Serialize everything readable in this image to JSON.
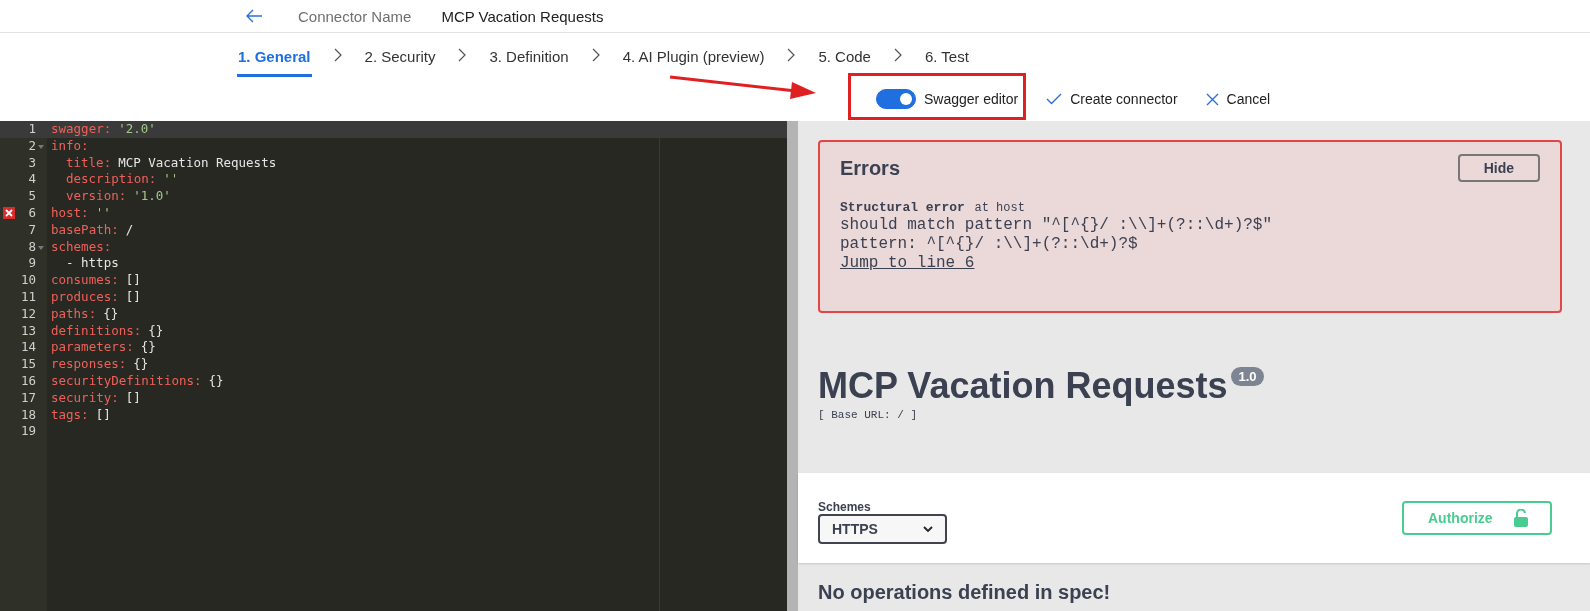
{
  "header": {
    "label": "Connector Name",
    "connector_name": "MCP Vacation Requests"
  },
  "steps": [
    {
      "label": "1. General",
      "selected": true
    },
    {
      "label": "2. Security",
      "selected": false
    },
    {
      "label": "3. Definition",
      "selected": false
    },
    {
      "label": "4. AI Plugin (preview)",
      "selected": false
    },
    {
      "label": "5. Code",
      "selected": false
    },
    {
      "label": "6. Test",
      "selected": false
    }
  ],
  "toolbar": {
    "swagger_editor": {
      "label": "Swagger editor",
      "on": true
    },
    "actions": [
      {
        "kind": "check",
        "label": "Create connector"
      },
      {
        "kind": "close",
        "label": "Cancel"
      }
    ]
  },
  "code_lines": [
    {
      "number": "1",
      "key": "swagger:",
      "value": "'2.0'",
      "kind": "string",
      "current": true,
      "error": false
    },
    {
      "number": "2",
      "key": "info:",
      "current": false,
      "error": false,
      "children": [
        {
          "number": "3",
          "key": "title:",
          "value": "MCP Vacation Requests",
          "kind": "plain",
          "current": false,
          "error": false
        },
        {
          "number": "4",
          "key": "description:",
          "value": "''",
          "kind": "string",
          "current": false,
          "error": false
        },
        {
          "number": "5",
          "key": "version:",
          "value": "'1.0'",
          "kind": "string",
          "current": false,
          "error": false
        }
      ]
    },
    {
      "number": "6",
      "key": "host:",
      "value": "''",
      "kind": "string",
      "current": false,
      "error": true
    },
    {
      "number": "7",
      "key": "basePath:",
      "value": "/",
      "kind": "plain",
      "current": false,
      "error": false
    },
    {
      "number": "8",
      "key": "schemes:",
      "current": false,
      "error": false,
      "children": [
        {
          "number": "9",
          "value": "- https",
          "kind": "plain",
          "current": false,
          "error": false
        }
      ]
    },
    {
      "number": "10",
      "key": "consumes:",
      "value": "[]",
      "kind": "plain",
      "current": false,
      "error": false
    },
    {
      "number": "11",
      "key": "produces:",
      "value": "[]",
      "kind": "plain",
      "current": false,
      "error": false
    },
    {
      "number": "12",
      "key": "paths:",
      "value": "{}",
      "kind": "plain",
      "current": false,
      "error": false
    },
    {
      "number": "13",
      "key": "definitions:",
      "value": "{}",
      "kind": "plain",
      "current": false,
      "error": false
    },
    {
      "number": "14",
      "key": "parameters:",
      "value": "{}",
      "kind": "plain",
      "current": false,
      "error": false
    },
    {
      "number": "15",
      "key": "responses:",
      "value": "{}",
      "kind": "plain",
      "current": false,
      "error": false
    },
    {
      "number": "16",
      "key": "securityDefinitions:",
      "value": "{}",
      "kind": "plain",
      "current": false,
      "error": false
    },
    {
      "number": "17",
      "key": "security:",
      "value": "[]",
      "kind": "plain",
      "current": false,
      "error": false
    },
    {
      "number": "18",
      "key": "tags:",
      "value": "[]",
      "kind": "plain",
      "current": false,
      "error": false
    },
    {
      "number": "19",
      "current": false,
      "error": false
    }
  ],
  "errors": {
    "title": "Errors",
    "hide_button": "Hide",
    "error_type": "Structural error",
    "location": "at host",
    "messages": [
      "should match pattern \"^[^{}/ :\\\\]+(?::\\d+)?$\"",
      "pattern: ^[^{}/ :\\\\]+(?::\\d+)?$"
    ],
    "link": "Jump to line 6"
  },
  "api": {
    "title": "MCP Vacation Requests",
    "version": "1.0",
    "base_url": "[ Base URL: / ]"
  },
  "schemes": {
    "label": "Schemes",
    "value": "HTTPS"
  },
  "authorize_button": "Authorize",
  "operations_message": "No operations defined in spec!"
}
